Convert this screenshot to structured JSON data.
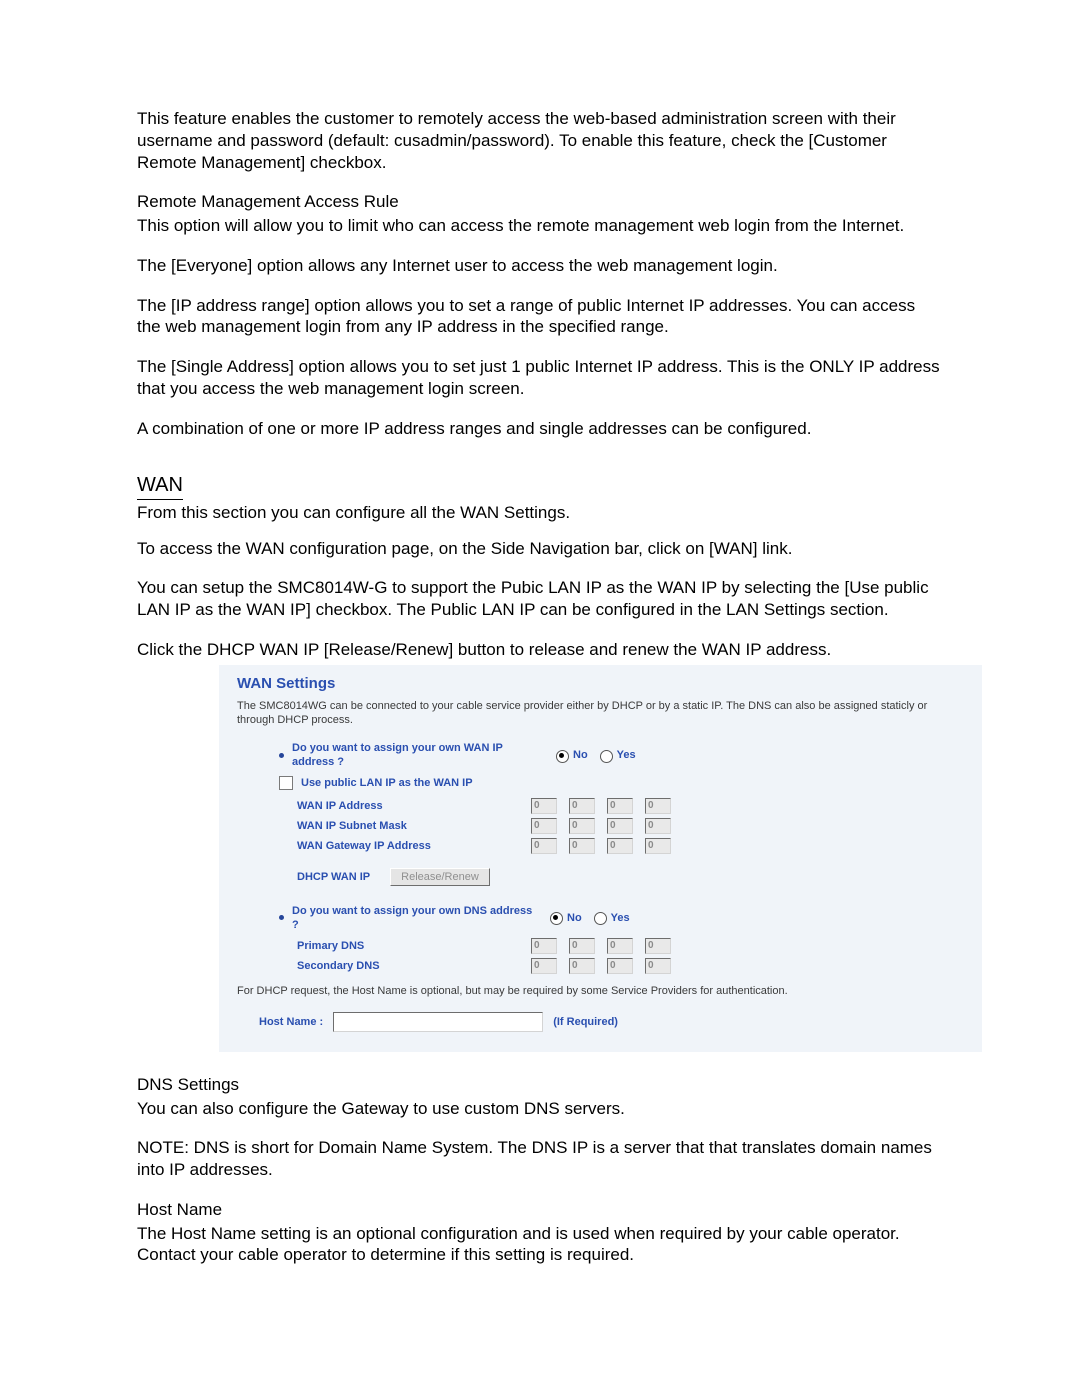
{
  "doc": {
    "p1": "This feature enables the customer to remotely access the web-based administration screen with their username and password (default: cusadmin/password).  To enable this feature, check the [Customer Remote Management] checkbox.",
    "h_remote": "Remote Management Access Rule",
    "p2": "This option will allow you to limit who can access the remote management web login from the Internet.",
    "p3": "The [Everyone] option allows any Internet user to access the web management login.",
    "p4": "The [IP address range] option allows you to set a range of public Internet IP addresses. You can access the web management login from any IP address in the specified range.",
    "p5": "The [Single Address] option allows you to set just 1 public Internet IP address. This is the ONLY IP address that you access the web management login screen.",
    "p6": "A combination of one or more IP address ranges and single addresses can be configured.",
    "h_wan": "WAN",
    "p7": "From this section you can configure all the WAN Settings.",
    "p8": "To access the WAN configuration page, on the Side Navigation bar, click on [WAN] link.",
    "p9": "You can setup the SMC8014W-G to support the Pubic LAN IP as the WAN IP by selecting the [Use public LAN IP as the WAN IP] checkbox.  The Public LAN IP can be configured in the LAN Settings section.",
    "p10": "Click the DHCP WAN IP [Release/Renew] button to release and renew the WAN IP address.",
    "h_dns": "DNS Settings",
    "p11": "You can also configure the Gateway to use custom DNS servers.",
    "p12": "NOTE: DNS is short for Domain Name System.  The DNS IP is a server that that translates domain names into IP addresses.",
    "h_host": "Host Name",
    "p13": "The Host Name setting is an optional configuration and is used when required by your cable operator.  Contact your cable operator to determine if this setting is required."
  },
  "shot": {
    "title": "WAN Settings",
    "desc": "The SMC8014WG can be connected to your cable service provider either by DHCP or by a static IP. The DNS can also be assigned staticly or through DHCP process.",
    "q_wan": "Do you want to assign your own WAN IP address ?",
    "no": "No",
    "yes": "Yes",
    "use_public": "Use public LAN IP as the WAN IP",
    "wan_ip": "WAN IP Address",
    "wan_subnet": "WAN IP Subnet Mask",
    "wan_gw": "WAN Gateway IP Address",
    "dhcp_label": "DHCP WAN IP",
    "btn": "Release/Renew",
    "q_dns": "Do you want to assign your own DNS address ?",
    "pri_dns": "Primary DNS",
    "sec_dns": "Secondary DNS",
    "note": "For DHCP request, the Host Name is optional, but may be required by some Service Providers for authentication.",
    "host_label": "Host Name :",
    "if_req": "(If Required)",
    "ip_val": "0"
  }
}
